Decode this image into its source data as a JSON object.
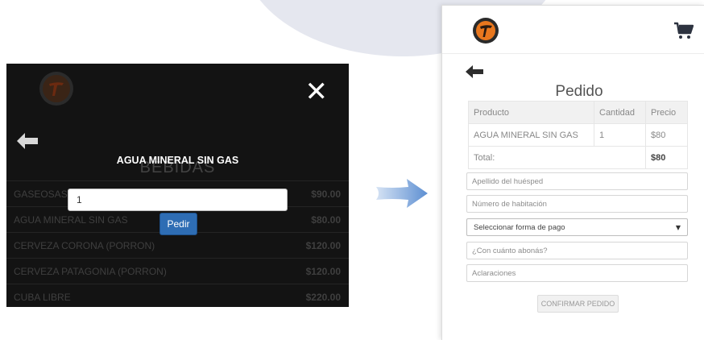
{
  "left_phone": {
    "section_title": "BEBIDAS",
    "items": [
      {
        "name": "GASEOSAS",
        "price": "$90.00"
      },
      {
        "name": "AGUA MINERAL SIN GAS",
        "price": "$80.00"
      },
      {
        "name": "CERVEZA CORONA (PORRON)",
        "price": "$120.00"
      },
      {
        "name": "CERVEZA PATAGONIA (PORRON)",
        "price": "$120.00"
      },
      {
        "name": "CUBA LIBRE",
        "price": "$220.00"
      }
    ],
    "modal": {
      "title": "AGUA MINERAL SIN GAS",
      "quantity_value": "1",
      "submit_label": "Pedir",
      "close_glyph": "✕"
    }
  },
  "right_phone": {
    "title": "Pedido",
    "table": {
      "headers": [
        "Producto",
        "Cantidad",
        "Precio"
      ],
      "rows": [
        {
          "product": "AGUA MINERAL SIN GAS",
          "quantity": "1",
          "price": "$80"
        }
      ],
      "total_label": "Total:",
      "total_value": "$80"
    },
    "fields": {
      "guest_last_name": "Apellido del huésped",
      "room_number": "Número de habitación",
      "payment_select": "Seleccionar forma de pago",
      "pay_amount": "¿Con cuánto abonás?",
      "notes": "Aclaraciones"
    },
    "confirm_label": "CONFIRMAR PEDIDO"
  },
  "icons": {
    "logo": "logo-icon",
    "close": "close-icon",
    "back": "back-arrow-icon",
    "cart": "cart-icon",
    "transition": "right-arrow-icon"
  },
  "colors": {
    "brand_orange": "#e8771e",
    "modal_button": "#2e6db4",
    "arrow_blue": "#6f9bd6"
  }
}
